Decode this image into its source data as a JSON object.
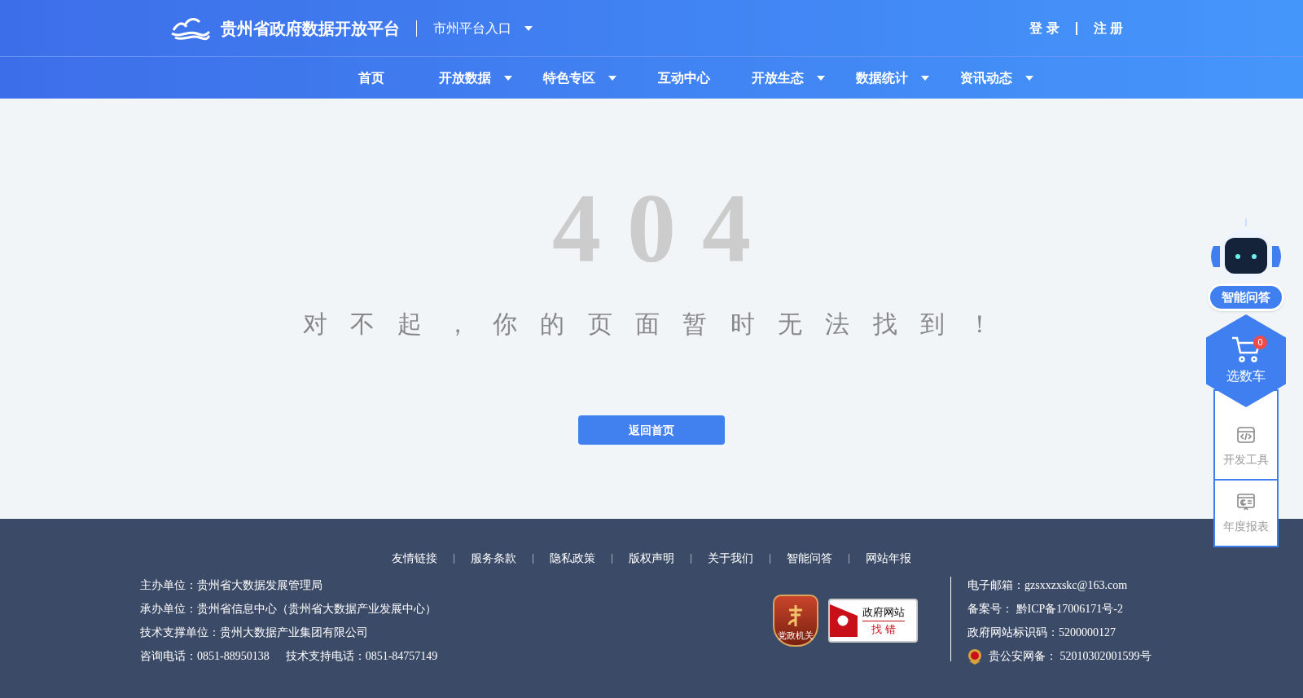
{
  "header": {
    "site_title": "贵州省政府数据开放平台",
    "city_entry": "市州平台入口",
    "auth_links": [
      "登 录",
      "注 册"
    ]
  },
  "nav": [
    {
      "label": "首页",
      "dropdown": false
    },
    {
      "label": "开放数据",
      "dropdown": true
    },
    {
      "label": "特色专区",
      "dropdown": true
    },
    {
      "label": "互动中心",
      "dropdown": false
    },
    {
      "label": "开放生态",
      "dropdown": true
    },
    {
      "label": "数据统计",
      "dropdown": true
    },
    {
      "label": "资讯动态",
      "dropdown": true
    }
  ],
  "error": {
    "code": "404",
    "message": "对 不 起 ， 你 的 页 面 暂 时 无 法 找 到 ！",
    "button": "返回首页"
  },
  "side_widget": {
    "assistant": "智能问答",
    "cart": {
      "label": "选数车",
      "count": "0"
    },
    "tools": [
      {
        "kind": "code",
        "label": "开发工具"
      },
      {
        "kind": "report",
        "label": "年度报表"
      }
    ]
  },
  "footer": {
    "links": [
      "友情链接",
      "服务条款",
      "隐私政策",
      "版权声明",
      "关于我们",
      "智能问答",
      "网站年报"
    ],
    "info_left": [
      "主办单位：贵州省大数据发展管理局",
      "承办单位：贵州省信息中心（贵州省大数据产业发展中心）",
      "技术支撑单位：贵州大数据产业集团有限公司"
    ],
    "phones": [
      "咨询电话：0851-88950138",
      "技术支持电话：0851-84757149"
    ],
    "badges": {
      "party": "党政机关",
      "gov_top": "政府网站",
      "gov_bottom": "找 错"
    },
    "info_right": [
      "电子邮箱：gzsxxzxskc@163.com",
      "备案号： 黔ICP备17006171号-2",
      "政府网站标识码：5200000127"
    ],
    "police": "贵公安网备： 52010302001599号"
  }
}
